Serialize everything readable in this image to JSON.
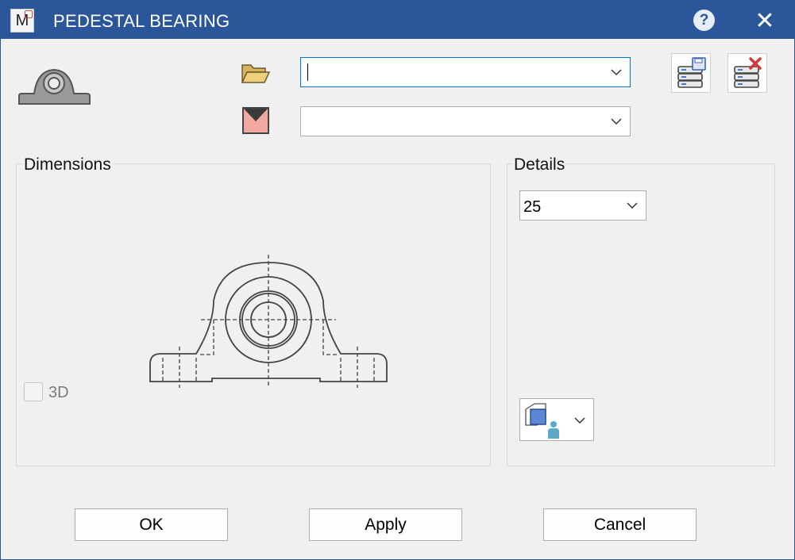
{
  "window": {
    "title": "PEDESTAL BEARING",
    "app_icon_letter": "M"
  },
  "titlebar": {
    "help_label": "?",
    "close_label": "✕"
  },
  "file_combo": {
    "value": ""
  },
  "color_combo": {
    "value": ""
  },
  "groups": {
    "dimensions_title": "Dimensions",
    "details_title": "Details"
  },
  "details": {
    "size_value": "25"
  },
  "options": {
    "three_d_label": "3D",
    "three_d_checked": false
  },
  "buttons": {
    "ok": "OK",
    "apply": "Apply",
    "cancel": "Cancel"
  },
  "colors": {
    "titlebar": "#2b579a",
    "folder": "#e8c36a",
    "swatch": "#f0a8a0",
    "accent": "#0078d7"
  },
  "icons": [
    "app-logo-icon",
    "help-icon",
    "close-icon",
    "pedestal-bearing-icon",
    "folder-icon",
    "color-swatch-icon",
    "save-database-icon",
    "delete-database-icon",
    "view-user-icon",
    "chevron-down-icon"
  ]
}
